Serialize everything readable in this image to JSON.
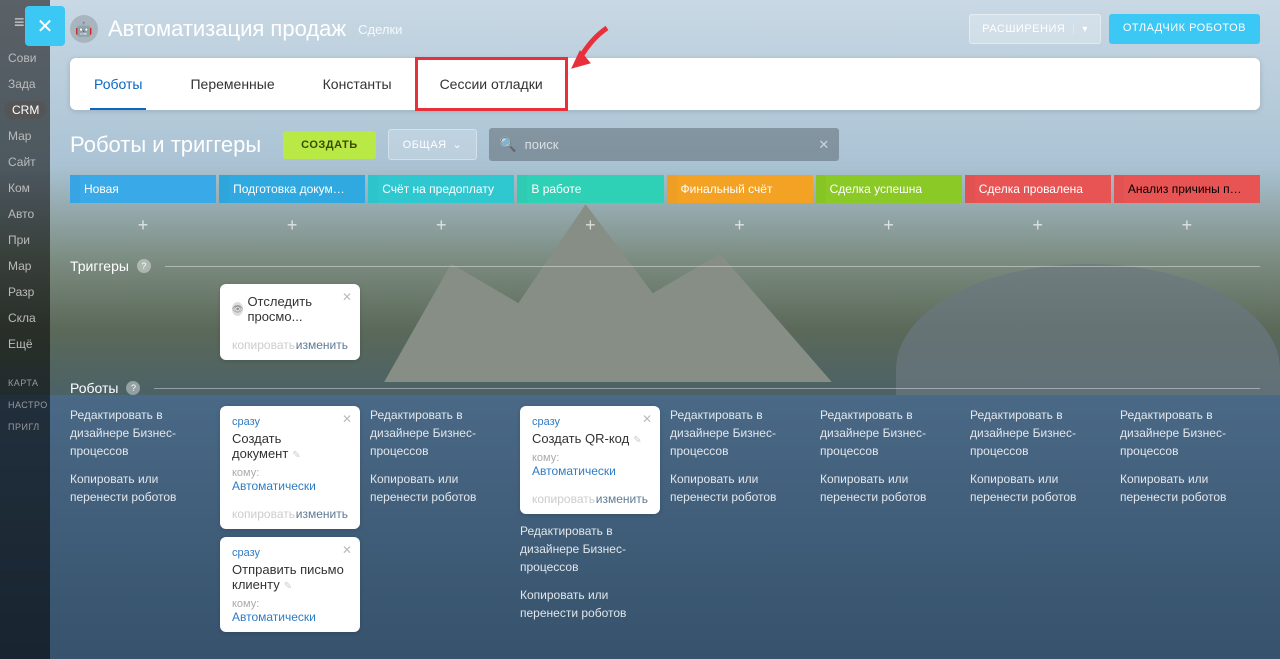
{
  "sidebar": {
    "items": [
      "Сови",
      "Зада",
      "CRM",
      "Мар",
      "Сайт",
      "Ком",
      "Авто",
      "При",
      "Мар",
      "Разр",
      "Скла",
      "Ещё"
    ],
    "active_index": 2,
    "groups": [
      "КАРТА",
      "НАСТРО",
      "ПРИГЛ"
    ]
  },
  "header": {
    "title": "Автоматизация продаж",
    "subtitle": "Сделки",
    "extensions_btn": "РАСШИРЕНИЯ",
    "debugger_btn": "ОТЛАДЧИК РОБОТОВ"
  },
  "tabs": [
    {
      "label": "Роботы",
      "active": true,
      "highlighted": false
    },
    {
      "label": "Переменные",
      "active": false,
      "highlighted": false
    },
    {
      "label": "Константы",
      "active": false,
      "highlighted": false
    },
    {
      "label": "Сессии отладки",
      "active": false,
      "highlighted": true
    }
  ],
  "toolbar": {
    "section_title": "Роботы и триггеры",
    "create_btn": "СОЗДАТЬ",
    "general_btn": "ОБЩАЯ",
    "search_placeholder": "поиск"
  },
  "stages": [
    {
      "label": "Новая",
      "color": "#39a9e8"
    },
    {
      "label": "Подготовка документов",
      "color": "#2fa9e0"
    },
    {
      "label": "Счёт на предоплату",
      "color": "#2fc8d1"
    },
    {
      "label": "В работе",
      "color": "#2fd1b6"
    },
    {
      "label": "Финальный счёт",
      "color": "#f3a224"
    },
    {
      "label": "Сделка успешна",
      "color": "#8ac926"
    },
    {
      "label": "Сделка провалена",
      "color": "#e85454"
    },
    {
      "label": "Анализ причины пр...",
      "color": "#e85454"
    }
  ],
  "sections": {
    "triggers": "Триггеры",
    "robots": "Роботы"
  },
  "trigger_card": {
    "title": "Отследить просмо...",
    "copy": "копировать",
    "edit": "изменить"
  },
  "links": {
    "edit_designer": "Редактировать в дизайнере Бизнес-процессов",
    "copy_move": "Копировать или перенести роботов"
  },
  "robot_cards": {
    "lane1": [
      {
        "tag": "сразу",
        "title": "Создать документ",
        "to_label": "кому:",
        "to_value": "Автоматически"
      },
      {
        "tag": "сразу",
        "title": "Отправить письмо клиенту",
        "to_label": "кому:",
        "to_value": "Автоматически"
      }
    ],
    "lane3": [
      {
        "tag": "сразу",
        "title": "Создать QR-код",
        "to_label": "кому:",
        "to_value": "Автоматически"
      }
    ]
  },
  "card_footer": {
    "copy": "копировать",
    "edit": "изменить"
  }
}
